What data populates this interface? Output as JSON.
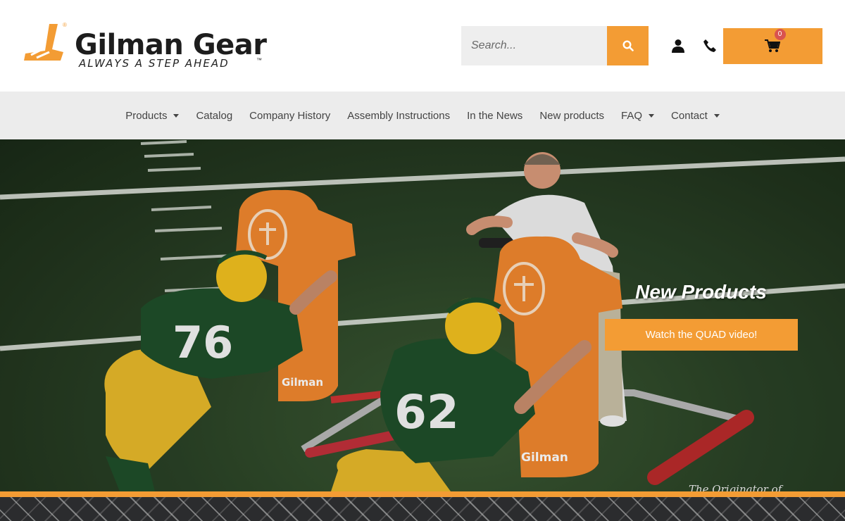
{
  "brand": {
    "name": "Gilman Gear",
    "tagline": "ALWAYS A STEP AHEAD",
    "trademark": "™",
    "registered": "®"
  },
  "search": {
    "placeholder": "Search..."
  },
  "cart": {
    "count": "0"
  },
  "nav": {
    "items": [
      {
        "label": "Products",
        "has_dropdown": true
      },
      {
        "label": "Catalog",
        "has_dropdown": false
      },
      {
        "label": "Company History",
        "has_dropdown": false
      },
      {
        "label": "Assembly Instructions",
        "has_dropdown": false
      },
      {
        "label": "In the News",
        "has_dropdown": false
      },
      {
        "label": "New products",
        "has_dropdown": false
      },
      {
        "label": "FAQ",
        "has_dropdown": true
      },
      {
        "label": "Contact",
        "has_dropdown": true
      }
    ]
  },
  "hero": {
    "title": "New Products",
    "button_label": "Watch the QUAD video!",
    "script_text": "The Originator of",
    "jersey_left": "76",
    "jersey_right": "62",
    "sled_brand": "Gilman"
  },
  "colors": {
    "accent": "#f39c34",
    "nav_bg": "#ececec",
    "badge": "#d9534f"
  },
  "icons": [
    "search-icon",
    "user-icon",
    "phone-icon",
    "cart-icon",
    "chevron-down-icon"
  ]
}
